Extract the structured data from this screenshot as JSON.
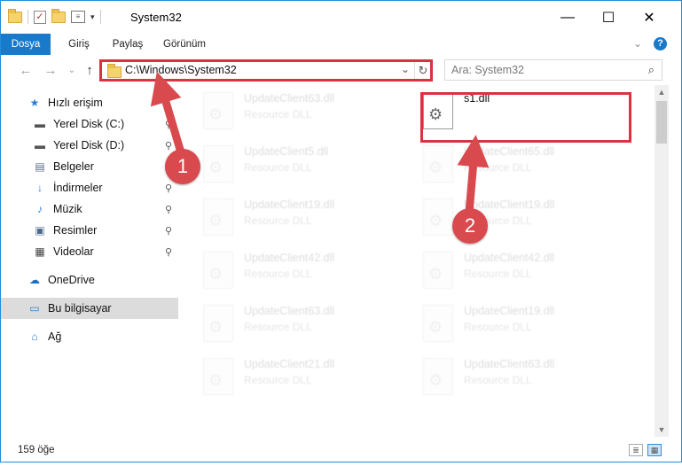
{
  "window": {
    "title": "System32",
    "controls": {
      "minimize": "—",
      "maximize": "☐",
      "close": "✕"
    }
  },
  "ribbon": {
    "tabs": [
      "Dosya",
      "Giriş",
      "Paylaş",
      "Görünüm"
    ],
    "collapse_icon": "chevron-down-icon",
    "help_icon": "?"
  },
  "address_bar": {
    "path": "C:\\Windows\\System32",
    "dropdown_icon": "⌄",
    "refresh_icon": "↻"
  },
  "search": {
    "placeholder": "Ara: System32",
    "icon": "⌕"
  },
  "sidebar": {
    "items": [
      {
        "label": "Hızlı erişim",
        "icon": "★",
        "pinned": false
      },
      {
        "label": "Yerel Disk (C:)",
        "icon": "▬",
        "pinned": true
      },
      {
        "label": "Yerel Disk (D:)",
        "icon": "▬",
        "pinned": true
      },
      {
        "label": "Belgeler",
        "icon": "▤",
        "pinned": true
      },
      {
        "label": "İndirmeler",
        "icon": "↓",
        "pinned": true
      },
      {
        "label": "Müzik",
        "icon": "♪",
        "pinned": true
      },
      {
        "label": "Resimler",
        "icon": "▣",
        "pinned": true
      },
      {
        "label": "Videolar",
        "icon": "▦",
        "pinned": true
      },
      {
        "label": "OneDrive",
        "icon": "☁",
        "pinned": false
      },
      {
        "label": "Bu bilgisayar",
        "icon": "▭",
        "pinned": false
      },
      {
        "label": "Ağ",
        "icon": "⌂",
        "pinned": false
      }
    ],
    "pin_icon": "📌"
  },
  "files": {
    "left": [
      {
        "name": "UpdateClient63.dll",
        "type": "Resource DLL"
      },
      {
        "name": "UpdateClient5.dll",
        "type": "Resource DLL"
      },
      {
        "name": "UpdateClient19.dll",
        "type": "Resource DLL"
      },
      {
        "name": "UpdateClient42.dll",
        "type": "Resource DLL"
      },
      {
        "name": "UpdateClient63.dll",
        "type": "Resource DLL"
      },
      {
        "name": "UpdateClient21.dll",
        "type": "Resource DLL"
      }
    ],
    "right": [
      {
        "name": "s1.dll",
        "type": ""
      },
      {
        "name": "UpdateClient65.dll",
        "type": "Resource DLL"
      },
      {
        "name": "UpdateClient19.dll",
        "type": "Resource DLL"
      },
      {
        "name": "UpdateClient42.dll",
        "type": "Resource DLL"
      },
      {
        "name": "UpdateClient19.dll",
        "type": "Resource DLL"
      },
      {
        "name": "UpdateClient63.dll",
        "type": "Resource DLL"
      }
    ]
  },
  "annotations": {
    "step1": "1",
    "step2": "2",
    "color": "#d94a4f"
  },
  "status": {
    "count": "159 öğe"
  }
}
